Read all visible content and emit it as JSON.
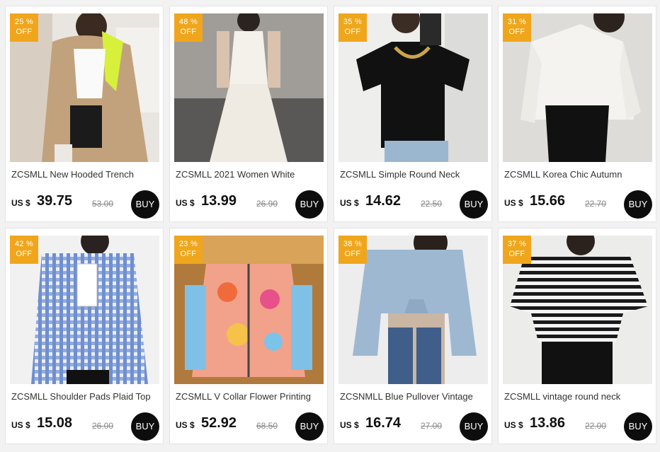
{
  "products": [
    {
      "badge_pct": "25 %",
      "badge_off": "OFF",
      "title": "ZCSMLL New Hooded Trench",
      "currency": "US $",
      "price": "39.75",
      "original_price": "53.00",
      "buy_label": "BUY"
    },
    {
      "badge_pct": "48 %",
      "badge_off": "OFF",
      "title": "ZCSMLL 2021 Women White",
      "currency": "US $",
      "price": "13.99",
      "original_price": "26.90",
      "buy_label": "BUY"
    },
    {
      "badge_pct": "35 %",
      "badge_off": "OFF",
      "title": "ZCSMLL Simple Round Neck",
      "currency": "US $",
      "price": "14.62",
      "original_price": "22.50",
      "buy_label": "BUY"
    },
    {
      "badge_pct": "31 %",
      "badge_off": "OFF",
      "title": "ZCSMLL Korea Chic Autumn",
      "currency": "US $",
      "price": "15.66",
      "original_price": "22.70",
      "buy_label": "BUY"
    },
    {
      "badge_pct": "42 %",
      "badge_off": "OFF",
      "title": "ZCSMLL Shoulder Pads Plaid  Top",
      "currency": "US $",
      "price": "15.08",
      "original_price": "26.00",
      "buy_label": "BUY"
    },
    {
      "badge_pct": "23 %",
      "badge_off": "OFF",
      "title": "ZCSMLL V Collar Flower Printing",
      "currency": "US $",
      "price": "52.92",
      "original_price": "68.50",
      "buy_label": "BUY"
    },
    {
      "badge_pct": "38 %",
      "badge_off": "OFF",
      "title": "ZCSNMLL Blue Pullover Vintage",
      "currency": "US $",
      "price": "16.74",
      "original_price": "27.00",
      "buy_label": "BUY"
    },
    {
      "badge_pct": "37 %",
      "badge_off": "OFF",
      "title": "ZCSMLL vintage round neck",
      "currency": "US $",
      "price": "13.86",
      "original_price": "22.00",
      "buy_label": "BUY"
    }
  ],
  "colors": {
    "badge": "#f0a61c",
    "buy_button": "#0d0d0d",
    "price_text": "#111111",
    "original_price_text": "#888888"
  }
}
